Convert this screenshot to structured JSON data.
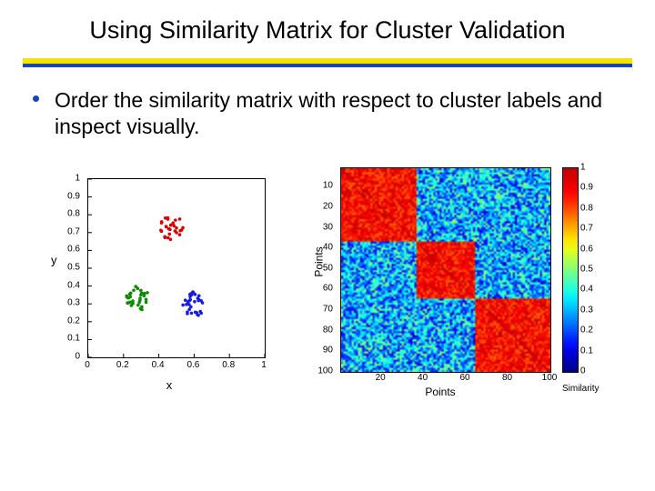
{
  "title": "Using Similarity Matrix for Cluster Validation",
  "bullet": "Order the similarity matrix with respect to cluster labels and inspect visually.",
  "chart_data": [
    {
      "type": "scatter",
      "xlabel": "x",
      "ylabel": "y",
      "xlim": [
        0,
        1
      ],
      "ylim": [
        0,
        1
      ],
      "xticks": [
        0,
        0.2,
        0.4,
        0.6,
        0.8,
        1
      ],
      "yticks": [
        0,
        0.1,
        0.2,
        0.3,
        0.4,
        0.5,
        0.6,
        0.7,
        0.8,
        0.9,
        1
      ],
      "series": [
        {
          "name": "cluster-red",
          "color": "#dc0000",
          "centroid": [
            0.47,
            0.73
          ],
          "spread": 0.07,
          "n": 28
        },
        {
          "name": "cluster-green",
          "color": "#0a8a00",
          "centroid": [
            0.28,
            0.33
          ],
          "spread": 0.07,
          "n": 30
        },
        {
          "name": "cluster-blue",
          "color": "#1a1ae6",
          "centroid": [
            0.6,
            0.3
          ],
          "spread": 0.07,
          "n": 32
        }
      ]
    },
    {
      "type": "heatmap",
      "xlabel": "Points",
      "ylabel": "Points",
      "xlim": [
        1,
        100
      ],
      "ylim": [
        1,
        100
      ],
      "xticks": [
        20,
        40,
        60,
        80,
        100
      ],
      "yticks": [
        10,
        20,
        30,
        40,
        50,
        60,
        70,
        80,
        90,
        100
      ],
      "colorbar": {
        "label": "Similarity",
        "ticks": [
          0,
          0.1,
          0.2,
          0.3,
          0.4,
          0.5,
          0.6,
          0.7,
          0.8,
          0.9,
          1
        ],
        "colormap": "jet"
      },
      "block_ranges": [
        {
          "cluster": "block1",
          "start": 1,
          "end": 36,
          "mean_similarity": 0.88
        },
        {
          "cluster": "block2",
          "start": 37,
          "end": 64,
          "mean_similarity": 0.88
        },
        {
          "cluster": "block3",
          "start": 65,
          "end": 100,
          "mean_similarity": 0.88
        }
      ],
      "off_block_mean_similarity": 0.3
    }
  ]
}
